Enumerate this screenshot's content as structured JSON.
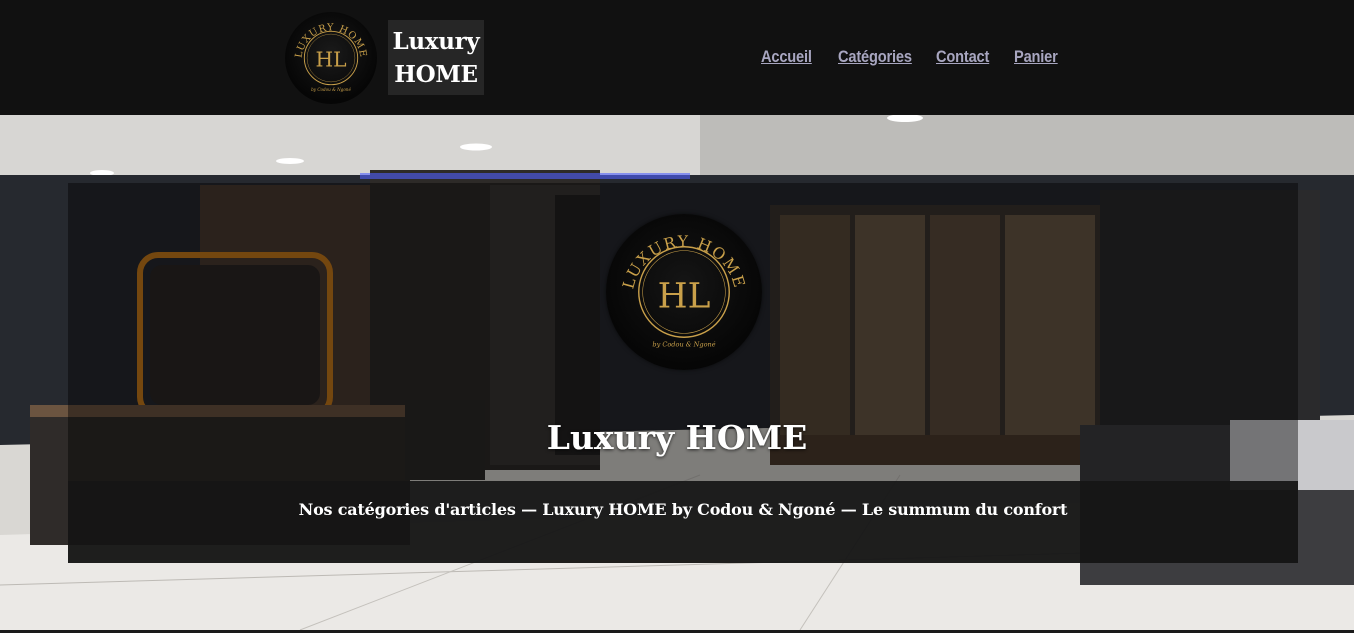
{
  "header": {
    "logo": {
      "text_top": "LUXURY HOME",
      "monogram": "HL",
      "tagline": "by Codou & Ngoné"
    },
    "brand_line1": "Luxury",
    "brand_line2": "HOME"
  },
  "nav": {
    "items": [
      {
        "label": "Accueil"
      },
      {
        "label": "Catégories"
      },
      {
        "label": "Contact"
      },
      {
        "label": "Panier"
      }
    ]
  },
  "hero": {
    "logo": {
      "text_top": "LUXURY HOME",
      "monogram": "HL",
      "tagline": "by Codou & Ngoné"
    },
    "title": "Luxury HOME",
    "subtitle": "Nos catégories d'articles — Luxury HOME by Codou & Ngoné — Le summum du confort"
  },
  "colors": {
    "header_bg": "#111111",
    "nav_link": "#a8a6c0",
    "gold": "#c9a04a",
    "text_white": "#ffffff"
  }
}
